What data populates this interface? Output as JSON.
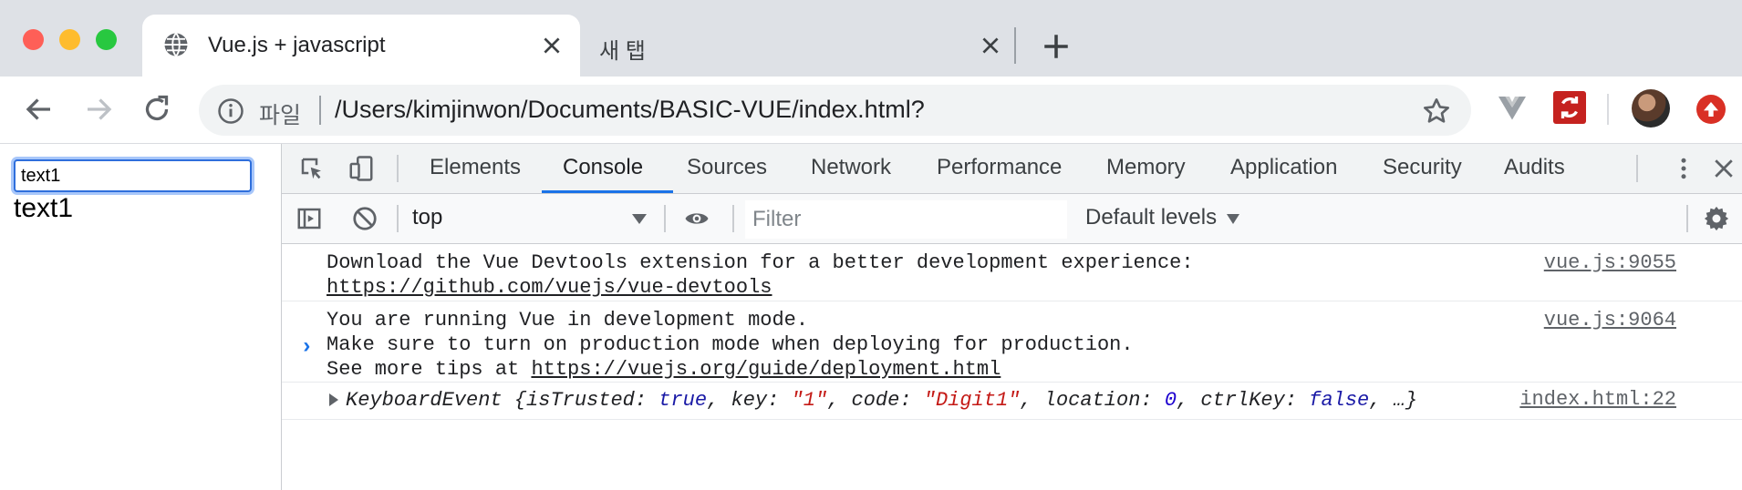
{
  "browser": {
    "tabs": [
      {
        "title": "Vue.js + javascript",
        "active": true
      },
      {
        "title": "새 탭",
        "active": false
      }
    ],
    "address_bar": {
      "scheme_label": "파일",
      "url": "/Users/kimjinwon/Documents/BASIC-VUE/index.html?"
    },
    "colors": {
      "accent": "#1a73e8",
      "tabstrip": "#dee1e6"
    }
  },
  "page": {
    "input_value": "text1",
    "output_text": "text1"
  },
  "devtools": {
    "tabs": [
      "Elements",
      "Console",
      "Sources",
      "Network",
      "Performance",
      "Memory",
      "Application",
      "Security",
      "Audits"
    ],
    "active_tab": "Console",
    "console": {
      "context": "top",
      "filter_placeholder": "Filter",
      "levels": "Default levels",
      "messages": [
        {
          "lines": [
            "Download the Vue Devtools extension for a better development experience:"
          ],
          "link": "https://github.com/vuejs/vue-devtools",
          "source": "vue.js:9055"
        },
        {
          "lines": [
            "You are running Vue in development mode.",
            "Make sure to turn on production mode when deploying for production."
          ],
          "link_prefix": "See more tips at ",
          "link": "https://vuejs.org/guide/deployment.html",
          "source": "vue.js:9064"
        },
        {
          "object": {
            "name": "KeyboardEvent",
            "open": " {",
            "k1": "isTrusted",
            "v1": "true",
            "k2": "key",
            "v2": "\"1\"",
            "k3": "code",
            "v3": "\"Digit1\"",
            "k4": "location",
            "v4": "0",
            "k5": "ctrlKey",
            "v5": "false",
            "tail": ", …}"
          },
          "source": "index.html:22"
        }
      ],
      "prompt": "›"
    }
  }
}
